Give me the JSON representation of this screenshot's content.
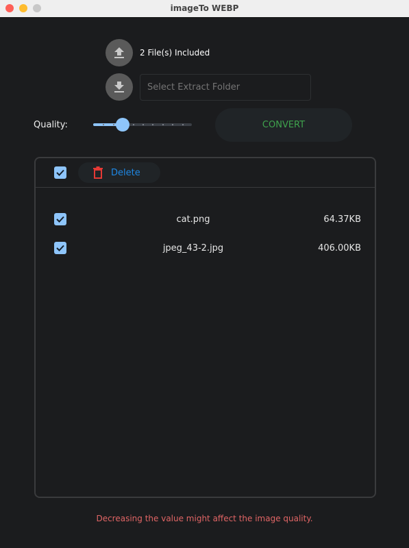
{
  "window": {
    "title": "imageTo WEBP"
  },
  "upload": {
    "icon": "upload-icon",
    "status": "2 File(s) Included"
  },
  "extract": {
    "icon": "download-icon",
    "placeholder": "Select Extract Folder",
    "value": ""
  },
  "quality": {
    "label": "Quality:",
    "value": 30,
    "min": 0,
    "max": 100
  },
  "convert": {
    "label": "CONVERT",
    "color": "#3fa34d"
  },
  "list": {
    "select_all": true,
    "delete_label": "Delete",
    "files": [
      {
        "name": "cat.png",
        "size": "64.37KB",
        "checked": true
      },
      {
        "name": "jpeg_43-2.jpg",
        "size": "406.00KB",
        "checked": true
      }
    ]
  },
  "warning": "Decreasing the value might affect the image quality.",
  "colors": {
    "accent": "#8ec5fb",
    "delete_icon": "#e53935",
    "delete_text": "#1e88e5",
    "warning": "#e06565"
  }
}
